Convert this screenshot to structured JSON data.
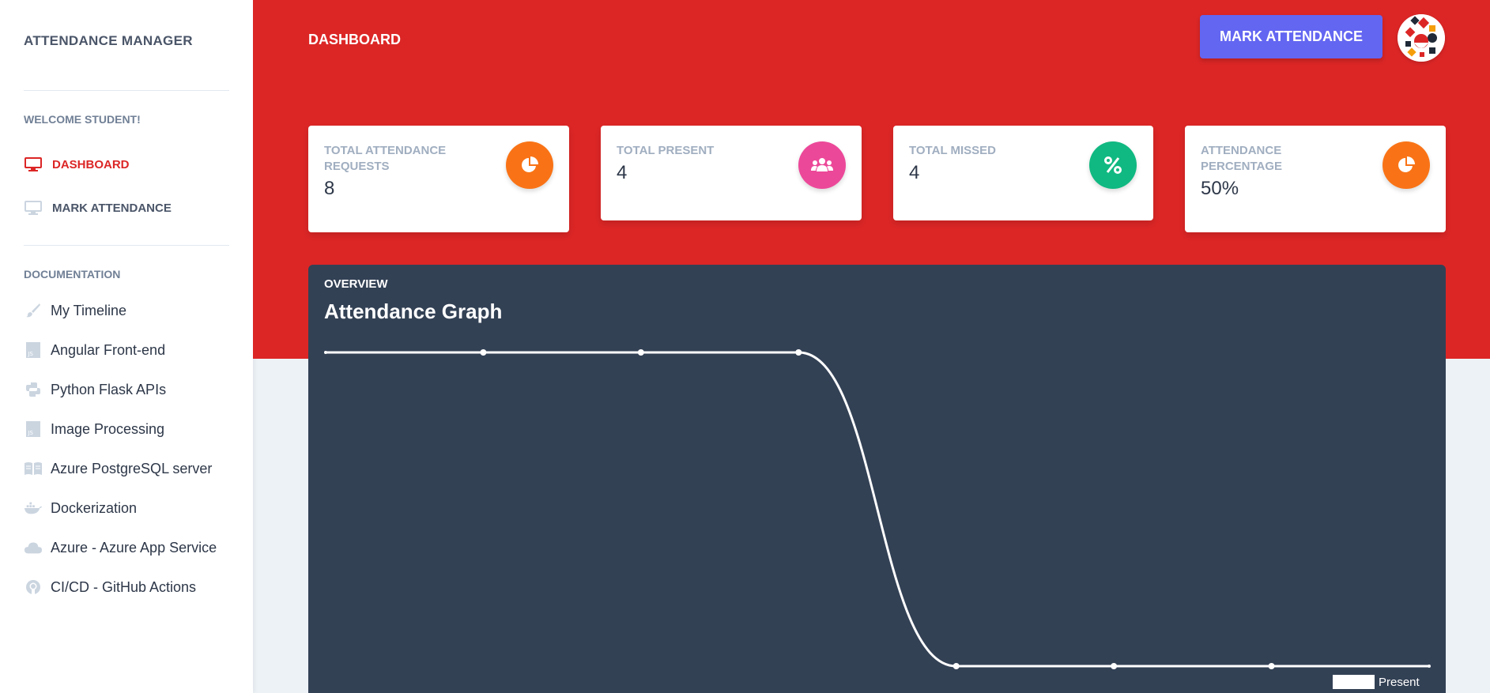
{
  "sidebar": {
    "brand": "ATTENDANCE MANAGER",
    "welcome": "WELCOME STUDENT!",
    "nav": [
      {
        "label": "DASHBOARD",
        "icon": "monitor-icon",
        "active": true
      },
      {
        "label": "MARK ATTENDANCE",
        "icon": "monitor-icon",
        "active": false
      }
    ],
    "docs_heading": "DOCUMENTATION",
    "docs": [
      {
        "label": "My Timeline",
        "icon": "paint-brush-icon"
      },
      {
        "label": "Angular Front-end",
        "icon": "js-file-icon"
      },
      {
        "label": "Python Flask APIs",
        "icon": "python-icon"
      },
      {
        "label": "Image Processing",
        "icon": "js-file-icon"
      },
      {
        "label": "Azure PostgreSQL server",
        "icon": "book-icon"
      },
      {
        "label": "Dockerization",
        "icon": "docker-icon"
      },
      {
        "label": "Azure - Azure App Service",
        "icon": "cloud-icon"
      },
      {
        "label": "CI/CD - GitHub Actions",
        "icon": "github-icon"
      }
    ]
  },
  "header": {
    "title": "DASHBOARD",
    "mark_button": "MARK ATTENDANCE",
    "accent_color": "#dc2626",
    "button_color": "#6366f1"
  },
  "stats": [
    {
      "label": "TOTAL ATTENDANCE REQUESTS",
      "value": "8",
      "icon": "pie-chart-icon",
      "color": "#f97316"
    },
    {
      "label": "TOTAL PRESENT",
      "value": "4",
      "icon": "users-icon",
      "color": "#ec4899"
    },
    {
      "label": "TOTAL MISSED",
      "value": "4",
      "icon": "percent-icon",
      "color": "#10b981"
    },
    {
      "label": "ATTENDANCE PERCENTAGE",
      "value": "50%",
      "icon": "pie-chart-icon",
      "color": "#f97316"
    }
  ],
  "chart": {
    "overline": "OVERVIEW",
    "title": "Attendance Graph",
    "legend": "Present"
  },
  "chart_data": {
    "type": "line",
    "title": "Attendance Graph",
    "x_count": 8,
    "series": [
      {
        "name": "Present",
        "values": [
          1,
          1,
          1,
          1,
          0,
          0,
          0,
          0
        ]
      }
    ],
    "ylim": [
      0,
      1
    ],
    "grid": false,
    "legend_position": "bottom-right"
  }
}
